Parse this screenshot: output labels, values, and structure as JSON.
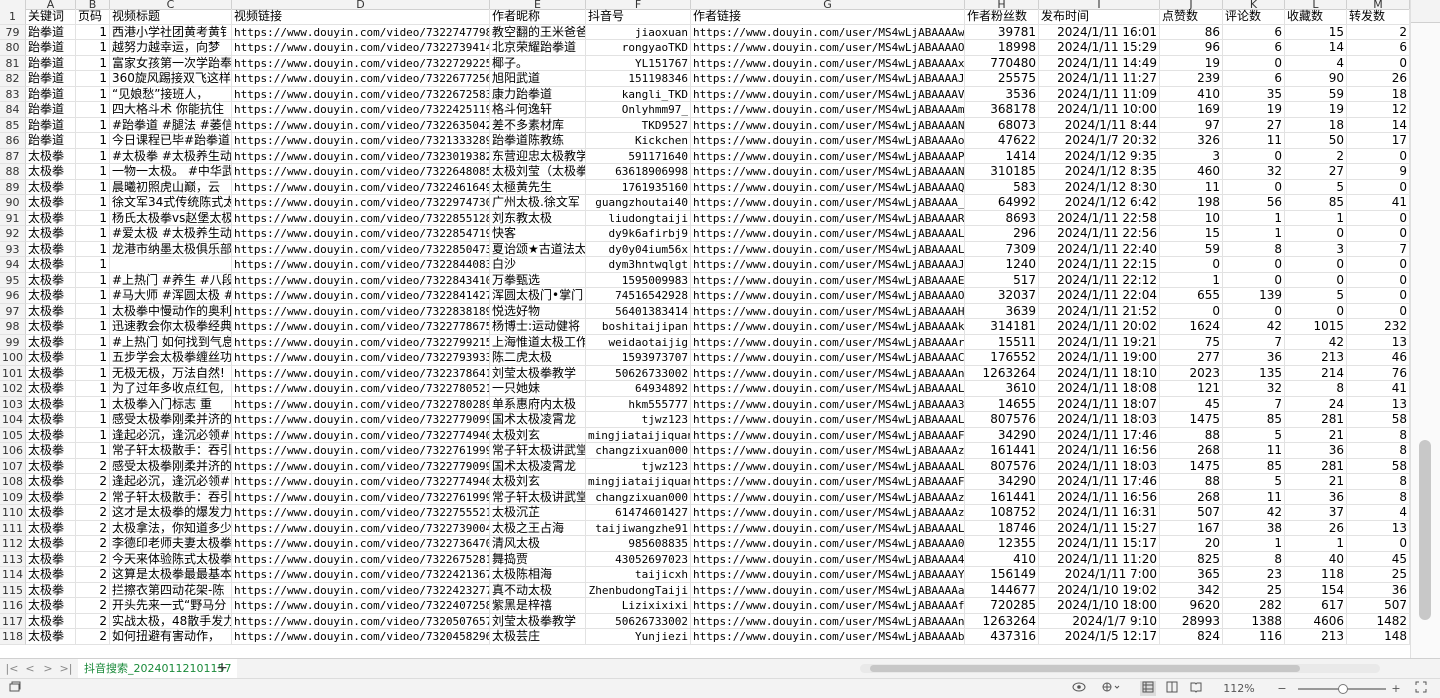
{
  "column_letters": [
    "A",
    "B",
    "C",
    "D",
    "E",
    "F",
    "G",
    "H",
    "I",
    "J",
    "K",
    "L",
    "M"
  ],
  "header_row_number": "1",
  "headers": [
    "关键词",
    "页码",
    "视频标题",
    "视频链接",
    "作者昵称",
    "抖音号",
    "作者链接",
    "作者粉丝数",
    "发布时间",
    "点赞数",
    "评论数",
    "收藏数",
    "转发数"
  ],
  "rows": [
    {
      "n": "79",
      "kw": "跆拳道",
      "pg": "1",
      "title": "西港小学社团黄考黄钅",
      "vurl": "https://www.douyin.com/video/7322747798840",
      "nick": "教空翻的王米爸爸",
      "did": "jiaoxuan",
      "aurl": "https://www.douyin.com/user/MS4wLjABAAAAwxbl",
      "fans": "39781",
      "time": "2024/1/11 16:01",
      "like": "86",
      "cmt": "6",
      "fav": "15",
      "fwd": "2"
    },
    {
      "n": "80",
      "kw": "跆拳道",
      "pg": "1",
      "title": "越努力越幸运，向梦",
      "vurl": "https://www.douyin.com/video/7322739414290",
      "nick": "北京荣耀跆拳道",
      "did": "rongyaoTKD",
      "aurl": "https://www.douyin.com/user/MS4wLjABAAAAOa3t",
      "fans": "18998",
      "time": "2024/1/11 15:29",
      "like": "96",
      "cmt": "6",
      "fav": "14",
      "fwd": "6"
    },
    {
      "n": "81",
      "kw": "跆拳道",
      "pg": "1",
      "title": "富家女孩第一次学跆奉",
      "vurl": "https://www.douyin.com/video/7322729225630",
      "nick": "椰子。",
      "did": "YL151767",
      "aurl": "https://www.douyin.com/user/MS4wLjABAAAAxeF-",
      "fans": "770480",
      "time": "2024/1/11 14:49",
      "like": "19",
      "cmt": "0",
      "fav": "4",
      "fwd": "0"
    },
    {
      "n": "82",
      "kw": "跆拳道",
      "pg": "1",
      "title": "360旋风踢接双飞这样",
      "vurl": "https://www.douyin.com/video/7322677256460",
      "nick": "旭阳武道",
      "did": "151198346",
      "aurl": "https://www.douyin.com/user/MS4wLjABAAAAJDiZ",
      "fans": "25575",
      "time": "2024/1/11 11:27",
      "like": "239",
      "cmt": "6",
      "fav": "90",
      "fwd": "26"
    },
    {
      "n": "83",
      "kw": "跆拳道",
      "pg": "1",
      "title": "“见娘愁”接班人，",
      "vurl": "https://www.douyin.com/video/7322672583810",
      "nick": "康力跆拳道",
      "did": "kangli_TKD",
      "aurl": "https://www.douyin.com/user/MS4wLjABAAAAVdTR",
      "fans": "3536",
      "time": "2024/1/11 11:09",
      "like": "410",
      "cmt": "35",
      "fav": "59",
      "fwd": "18"
    },
    {
      "n": "84",
      "kw": "跆拳道",
      "pg": "1",
      "title": "四大格斗术 你能抗住",
      "vurl": "https://www.douyin.com/video/7322425119850",
      "nick": "格斗何逸轩",
      "did": "Onlyhmm97_",
      "aurl": "https://www.douyin.com/user/MS4wLjABAAAAmfJL",
      "fans": "368178",
      "time": "2024/1/11 10:00",
      "like": "169",
      "cmt": "19",
      "fav": "19",
      "fwd": "12"
    },
    {
      "n": "85",
      "kw": "跆拳道",
      "pg": "1",
      "title": "#跆拳道 #腿法 #萎信",
      "vurl": "https://www.douyin.com/video/7322635042930",
      "nick": "差不多素材库",
      "did": "TKD9527",
      "aurl": "https://www.douyin.com/user/MS4wLjABAAAANtIr",
      "fans": "68073",
      "time": "2024/1/11 8:44",
      "like": "97",
      "cmt": "27",
      "fav": "18",
      "fwd": "14"
    },
    {
      "n": "86",
      "kw": "跆拳道",
      "pg": "1",
      "title": "今日课程已毕#跆拳道",
      "vurl": "https://www.douyin.com/video/7321333289650",
      "nick": "跆拳道陈教练",
      "did": "Kickchen",
      "aurl": "https://www.douyin.com/user/MS4wLjABAAAAoLnS",
      "fans": "47622",
      "time": "2024/1/7 20:32",
      "like": "326",
      "cmt": "11",
      "fav": "50",
      "fwd": "17"
    },
    {
      "n": "87",
      "kw": "太极拳",
      "pg": "1",
      "title": "#太极拳 #太极养生动",
      "vurl": "https://www.douyin.com/video/7323019382420",
      "nick": "东营迎忠太极教学",
      "did": "591171640",
      "aurl": "https://www.douyin.com/user/MS4wLjABAAAAP_tU",
      "fans": "1414",
      "time": "2024/1/12 9:35",
      "like": "3",
      "cmt": "0",
      "fav": "2",
      "fwd": "0"
    },
    {
      "n": "88",
      "kw": "太极拳",
      "pg": "1",
      "title": "一物一太极。 #中华武",
      "vurl": "https://www.douyin.com/video/7322648085960",
      "nick": "太极刘莹（太极拳",
      "did": "63618906998",
      "aurl": "https://www.douyin.com/user/MS4wLjABAAAANDsX",
      "fans": "310185",
      "time": "2024/1/12 8:35",
      "like": "460",
      "cmt": "32",
      "fav": "27",
      "fwd": "9"
    },
    {
      "n": "89",
      "kw": "太极拳",
      "pg": "1",
      "title": "晨曦初照虎山巅，云",
      "vurl": "https://www.douyin.com/video/7322461649820",
      "nick": "太極黄先生",
      "did": "1761935160",
      "aurl": "https://www.douyin.com/user/MS4wLjABAAAAQgNl",
      "fans": "583",
      "time": "2024/1/12 8:30",
      "like": "11",
      "cmt": "0",
      "fav": "5",
      "fwd": "0"
    },
    {
      "n": "90",
      "kw": "太极拳",
      "pg": "1",
      "title": "徐文军34式传统陈式太",
      "vurl": "https://www.douyin.com/video/7322974730160",
      "nick": "广州太极.徐文军",
      "did": "guangzhoutai40",
      "aurl": "https://www.douyin.com/user/MS4wLjABAAAA_sSw",
      "fans": "64992",
      "time": "2024/1/12 6:42",
      "like": "198",
      "cmt": "56",
      "fav": "85",
      "fwd": "41"
    },
    {
      "n": "91",
      "kw": "太极拳",
      "pg": "1",
      "title": "杨氏太极拳vs赵堡太极",
      "vurl": "https://www.douyin.com/video/7322855128410",
      "nick": "刘东教太极",
      "did": "liudongtaiji",
      "aurl": "https://www.douyin.com/user/MS4wLjABAAAARTFC",
      "fans": "8693",
      "time": "2024/1/11 22:58",
      "like": "10",
      "cmt": "1",
      "fav": "1",
      "fwd": "0"
    },
    {
      "n": "92",
      "kw": "太极拳",
      "pg": "1",
      "title": "#爱太极 #太极养生动",
      "vurl": "https://www.douyin.com/video/7322854719130",
      "nick": "快客",
      "did": "dy9k6afirbj9",
      "aurl": "https://www.douyin.com/user/MS4wLjABAAAALAV3",
      "fans": "296",
      "time": "2024/1/11 22:56",
      "like": "15",
      "cmt": "1",
      "fav": "0",
      "fwd": "0"
    },
    {
      "n": "93",
      "kw": "太极拳",
      "pg": "1",
      "title": "龙港市纳墨太极俱乐部",
      "vurl": "https://www.douyin.com/video/7322850473380",
      "nick": "夏诒颂★古道法太",
      "did": "dy0y04ium56x",
      "aurl": "https://www.douyin.com/user/MS4wLjABAAAALF1T",
      "fans": "7309",
      "time": "2024/1/11 22:40",
      "like": "59",
      "cmt": "8",
      "fav": "3",
      "fwd": "7"
    },
    {
      "n": "94",
      "kw": "太极拳",
      "pg": "1",
      "title": "",
      "vurl": "https://www.douyin.com/video/7322844083650",
      "nick": "白沙",
      "did": "dym3hntwqlgt",
      "aurl": "https://www.douyin.com/user/MS4wLjABAAAAJgvw",
      "fans": "1240",
      "time": "2024/1/11 22:15",
      "like": "0",
      "cmt": "0",
      "fav": "0",
      "fwd": "0"
    },
    {
      "n": "95",
      "kw": "太极拳",
      "pg": "1",
      "title": "#上热门 #养生 #八段",
      "vurl": "https://www.douyin.com/video/7322843410280",
      "nick": "万拳甄选",
      "did": "1595009983",
      "aurl": "https://www.douyin.com/user/MS4wLjABAAAAEHk6",
      "fans": "517",
      "time": "2024/1/11 22:12",
      "like": "1",
      "cmt": "0",
      "fav": "0",
      "fwd": "0"
    },
    {
      "n": "96",
      "kw": "太极拳",
      "pg": "1",
      "title": "#马大师 #浑圆太极 #",
      "vurl": "https://www.douyin.com/video/7322841427320",
      "nick": "浑圆太极门•掌门",
      "did": "74516542928",
      "aurl": "https://www.douyin.com/user/MS4wLjABAAAAOuOV",
      "fans": "32037",
      "time": "2024/1/11 22:04",
      "like": "655",
      "cmt": "139",
      "fav": "5",
      "fwd": "0"
    },
    {
      "n": "97",
      "kw": "太极拳",
      "pg": "1",
      "title": "太极拳中慢动作的奥利",
      "vurl": "https://www.douyin.com/video/7322838189670",
      "nick": "悦选好物",
      "did": "56401383414",
      "aurl": "https://www.douyin.com/user/MS4wLjABAAAAHjIu",
      "fans": "3639",
      "time": "2024/1/11 21:52",
      "like": "0",
      "cmt": "0",
      "fav": "0",
      "fwd": "0"
    },
    {
      "n": "98",
      "kw": "太极拳",
      "pg": "1",
      "title": "迅速教会你太极拳经典",
      "vurl": "https://www.douyin.com/video/7322778675770",
      "nick": "杨博士:运动健将",
      "did": "boshitaijipan",
      "aurl": "https://www.douyin.com/user/MS4wLjABAAAAka4t",
      "fans": "314181",
      "time": "2024/1/11 20:02",
      "like": "1624",
      "cmt": "42",
      "fav": "1015",
      "fwd": "232"
    },
    {
      "n": "99",
      "kw": "太极拳",
      "pg": "1",
      "title": "#上热门 如何找到气息",
      "vurl": "https://www.douyin.com/video/7322799215730",
      "nick": "上海惟道太极工作",
      "did": "weidaotaijig",
      "aurl": "https://www.douyin.com/user/MS4wLjABAAAArfWF",
      "fans": "15511",
      "time": "2024/1/11 19:21",
      "like": "75",
      "cmt": "7",
      "fav": "42",
      "fwd": "13"
    },
    {
      "n": "100",
      "kw": "太极拳",
      "pg": "1",
      "title": "五步学会太极拳缠丝功",
      "vurl": "https://www.douyin.com/video/7322793933320",
      "nick": "陈二虎太极",
      "did": "1593973707",
      "aurl": "https://www.douyin.com/user/MS4wLjABAAAACQsW",
      "fans": "176552",
      "time": "2024/1/11 19:00",
      "like": "277",
      "cmt": "36",
      "fav": "213",
      "fwd": "46"
    },
    {
      "n": "101",
      "kw": "太极拳",
      "pg": "1",
      "title": "无极无极，万法自然!",
      "vurl": "https://www.douyin.com/video/7322378641330",
      "nick": "刘莹太极拳教学",
      "did": "50626733002",
      "aurl": "https://www.douyin.com/user/MS4wLjABAAAAnHDc",
      "fans": "1263264",
      "time": "2024/1/11 18:10",
      "like": "2023",
      "cmt": "135",
      "fav": "214",
      "fwd": "76"
    },
    {
      "n": "102",
      "kw": "太极拳",
      "pg": "1",
      "title": "为了过年多收点红包,",
      "vurl": "https://www.douyin.com/video/7322780521510",
      "nick": "一只她妹",
      "did": "64934892",
      "aurl": "https://www.douyin.com/user/MS4wLjABAAAALxrK",
      "fans": "3610",
      "time": "2024/1/11 18:08",
      "like": "121",
      "cmt": "32",
      "fav": "8",
      "fwd": "41"
    },
    {
      "n": "103",
      "kw": "太极拳",
      "pg": "1",
      "title": "太极拳入门标志  重",
      "vurl": "https://www.douyin.com/video/7322780289040",
      "nick": "单系惠府内太极",
      "did": "hkm555777",
      "aurl": "https://www.douyin.com/user/MS4wLjABAAAA34oF",
      "fans": "14655",
      "time": "2024/1/11 18:07",
      "like": "45",
      "cmt": "7",
      "fav": "24",
      "fwd": "13"
    },
    {
      "n": "104",
      "kw": "太极拳",
      "pg": "1",
      "title": "感受太极拳刚柔并济的",
      "vurl": "https://www.douyin.com/video/7322779099270",
      "nick": "国术太极凌霄龙",
      "did": "tjwz123",
      "aurl": "https://www.douyin.com/user/MS4wLjABAAAALcAh",
      "fans": "807576",
      "time": "2024/1/11 18:03",
      "like": "1475",
      "cmt": "85",
      "fav": "281",
      "fwd": "58"
    },
    {
      "n": "105",
      "kw": "太极拳",
      "pg": "1",
      "title": "逢起必沉，逢沉必领#",
      "vurl": "https://www.douyin.com/video/7322774940740",
      "nick": "太极刘玄",
      "did": "mingjiataijiquan",
      "aurl": "https://www.douyin.com/user/MS4wLjABAAAAF81N",
      "fans": "34290",
      "time": "2024/1/11 17:46",
      "like": "88",
      "cmt": "5",
      "fav": "21",
      "fwd": "8"
    },
    {
      "n": "106",
      "kw": "太极拳",
      "pg": "1",
      "title": "常子轩太极散手：吞引",
      "vurl": "https://www.douyin.com/video/7322761999770",
      "nick": "常子轩太极讲武堂",
      "did": "changzixuan000",
      "aurl": "https://www.douyin.com/user/MS4wLjABAAAAzYAe",
      "fans": "161441",
      "time": "2024/1/11 16:56",
      "like": "268",
      "cmt": "11",
      "fav": "36",
      "fwd": "8"
    },
    {
      "n": "107",
      "kw": "太极拳",
      "pg": "2",
      "title": "感受太极拳刚柔并济的",
      "vurl": "https://www.douyin.com/video/7322779099270",
      "nick": "国术太极凌霄龙",
      "did": "tjwz123",
      "aurl": "https://www.douyin.com/user/MS4wLjABAAAALcAh",
      "fans": "807576",
      "time": "2024/1/11 18:03",
      "like": "1475",
      "cmt": "85",
      "fav": "281",
      "fwd": "58"
    },
    {
      "n": "108",
      "kw": "太极拳",
      "pg": "2",
      "title": "逢起必沉，逢沉必领#",
      "vurl": "https://www.douyin.com/video/7322774940740",
      "nick": "太极刘玄",
      "did": "mingjiataijiquan",
      "aurl": "https://www.douyin.com/user/MS4wLjABAAAAF81N",
      "fans": "34290",
      "time": "2024/1/11 17:46",
      "like": "88",
      "cmt": "5",
      "fav": "21",
      "fwd": "8"
    },
    {
      "n": "109",
      "kw": "太极拳",
      "pg": "2",
      "title": "常子轩太极散手：吞引",
      "vurl": "https://www.douyin.com/video/7322761999770",
      "nick": "常子轩太极讲武堂",
      "did": "changzixuan000",
      "aurl": "https://www.douyin.com/user/MS4wLjABAAAAzYAe",
      "fans": "161441",
      "time": "2024/1/11 16:56",
      "like": "268",
      "cmt": "11",
      "fav": "36",
      "fwd": "8"
    },
    {
      "n": "110",
      "kw": "太极拳",
      "pg": "2",
      "title": "这才是太极拳的爆发力",
      "vurl": "https://www.douyin.com/video/7322755521840",
      "nick": "太极沉芷",
      "did": "61474601427",
      "aurl": "https://www.douyin.com/user/MS4wLjABAAAAzii-",
      "fans": "108752",
      "time": "2024/1/11 16:31",
      "like": "507",
      "cmt": "42",
      "fav": "37",
      "fwd": "4"
    },
    {
      "n": "111",
      "kw": "太极拳",
      "pg": "2",
      "title": "太极拿法，你知道多少",
      "vurl": "https://www.douyin.com/video/7322739004400",
      "nick": "太极之王占海",
      "did": "taijiwangzhe91",
      "aurl": "https://www.douyin.com/user/MS4wLjABAAAALOju",
      "fans": "18746",
      "time": "2024/1/11 15:27",
      "like": "167",
      "cmt": "38",
      "fav": "26",
      "fwd": "13"
    },
    {
      "n": "112",
      "kw": "太极拳",
      "pg": "2",
      "title": "李德印老师夫妻太极拳",
      "vurl": "https://www.douyin.com/video/7322736470420",
      "nick": "清风太极",
      "did": "985608835",
      "aurl": "https://www.douyin.com/user/MS4wLjABAAAA0C9u",
      "fans": "12355",
      "time": "2024/1/11 15:17",
      "like": "20",
      "cmt": "1",
      "fav": "1",
      "fwd": "0"
    },
    {
      "n": "113",
      "kw": "太极拳",
      "pg": "2",
      "title": "今天来体验陈式太极拳",
      "vurl": "https://www.douyin.com/video/7322675281080",
      "nick": "舞捣贾",
      "did": "43052697023",
      "aurl": "https://www.douyin.com/user/MS4wLjABAAAA4TFt",
      "fans": "410",
      "time": "2024/1/11 11:20",
      "like": "825",
      "cmt": "8",
      "fav": "40",
      "fwd": "45"
    },
    {
      "n": "114",
      "kw": "太极拳",
      "pg": "2",
      "title": "这算是太极拳最最基本",
      "vurl": "https://www.douyin.com/video/7322421367280",
      "nick": "太极陈相海",
      "did": "taijicxh",
      "aurl": "https://www.douyin.com/user/MS4wLjABAAAAYfk7",
      "fans": "156149",
      "time": "2024/1/11 7:00",
      "like": "365",
      "cmt": "23",
      "fav": "118",
      "fwd": "25"
    },
    {
      "n": "115",
      "kw": "太极拳",
      "pg": "2",
      "title": "拦擦衣第四动花架-陈",
      "vurl": "https://www.douyin.com/video/7322423277170",
      "nick": "真不动太极",
      "did": "ZhenbudongTaiji",
      "aurl": "https://www.douyin.com/user/MS4wLjABAAAAa3i",
      "fans": "144677",
      "time": "2024/1/10 19:02",
      "like": "342",
      "cmt": "25",
      "fav": "154",
      "fwd": "36"
    },
    {
      "n": "116",
      "kw": "太极拳",
      "pg": "2",
      "title": "开头先来一式“野马分",
      "vurl": "https://www.douyin.com/video/7322407258640",
      "nick": "紫黑是梓禧",
      "did": "Lizixixixi",
      "aurl": "https://www.douyin.com/user/MS4wLjABAAAAfEB6",
      "fans": "720285",
      "time": "2024/1/10 18:00",
      "like": "9620",
      "cmt": "282",
      "fav": "617",
      "fwd": "507"
    },
    {
      "n": "117",
      "kw": "太极拳",
      "pg": "2",
      "title": "实战太极，48散手发力",
      "vurl": "https://www.douyin.com/video/7320507657830",
      "nick": "刘莹太极拳教学",
      "did": "50626733002",
      "aurl": "https://www.douyin.com/user/MS4wLjABAAAAnHDc",
      "fans": "1263264",
      "time": "2024/1/7 9:10",
      "like": "28993",
      "cmt": "1388",
      "fav": "4606",
      "fwd": "1482"
    },
    {
      "n": "118",
      "kw": "太极拳",
      "pg": "2",
      "title": "如何扭避有害动作，",
      "vurl": "https://www.douyin.com/video/7320458296760",
      "nick": "太极芸庄",
      "did": "Yunjiezi",
      "aurl": "https://www.douyin.com/user/MS4wLjABAAAAbLoU",
      "fans": "437316",
      "time": "2024/1/5 12:17",
      "like": "824",
      "cmt": "116",
      "fav": "213",
      "fwd": "148"
    }
  ],
  "sheet_tab": "抖音搜索_20240112101157",
  "nav_icons": [
    "first-sheet-icon",
    "prev-sheet-icon",
    "next-sheet-icon",
    "last-sheet-icon"
  ],
  "add_sheet": "+",
  "zoom": "112%",
  "colors": {
    "accent": "#1a8a3a",
    "grid": "#e2e2e2",
    "header_bg": "#f3f3f3"
  }
}
